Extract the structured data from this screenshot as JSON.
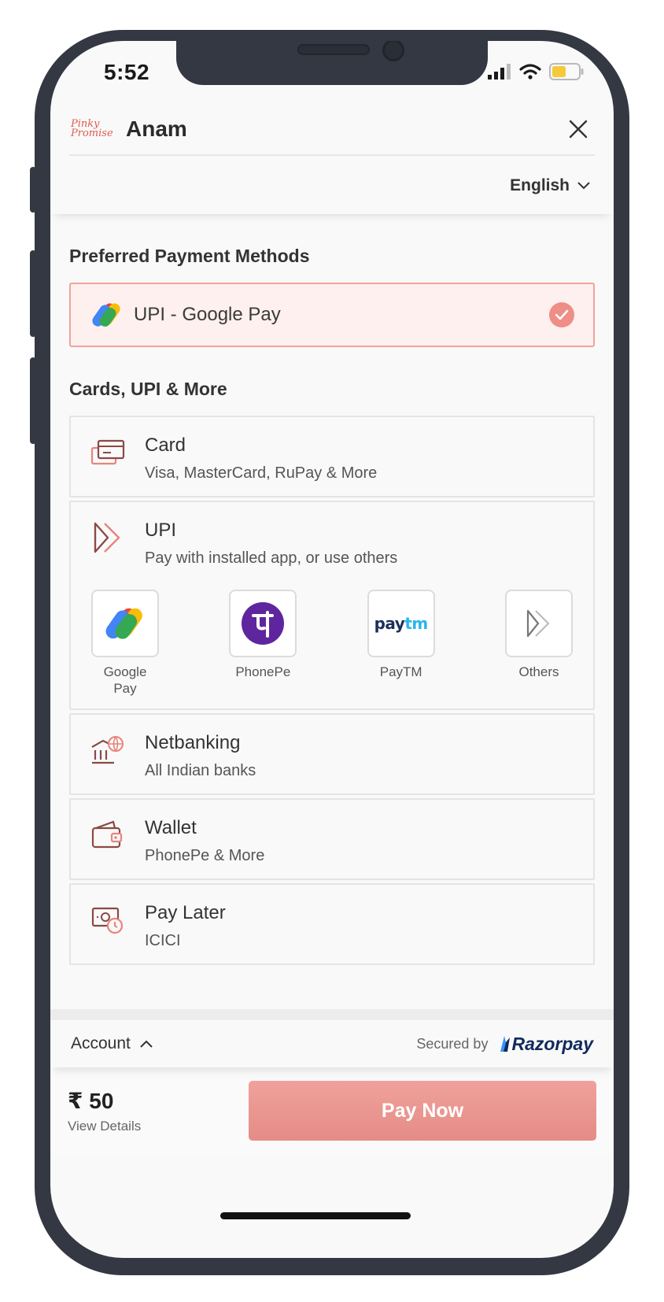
{
  "status_bar": {
    "time": "5:52"
  },
  "header": {
    "logo_line1": "Pinky",
    "logo_line2": "Promise",
    "merchant": "Anam"
  },
  "language": {
    "selected": "English"
  },
  "preferred": {
    "title": "Preferred Payment Methods",
    "item": "UPI - Google Pay"
  },
  "more": {
    "title": "Cards, UPI & More",
    "methods": [
      {
        "title": "Card",
        "subtitle": "Visa, MasterCard, RuPay & More"
      },
      {
        "title": "UPI",
        "subtitle": "Pay with installed app, or use others"
      },
      {
        "title": "Netbanking",
        "subtitle": "All Indian banks"
      },
      {
        "title": "Wallet",
        "subtitle": "PhonePe & More"
      },
      {
        "title": "Pay Later",
        "subtitle": "ICICI"
      }
    ],
    "upi_apps": [
      {
        "label": "Google Pay"
      },
      {
        "label": "PhonePe"
      },
      {
        "label": "PayTM",
        "logo_text": "paytm"
      },
      {
        "label": "Others"
      }
    ]
  },
  "footer": {
    "account": "Account",
    "secured_by": "Secured by",
    "brand": "Razorpay"
  },
  "pay": {
    "amount": "₹ 50",
    "view_details": "View Details",
    "button": "Pay Now"
  },
  "colors": {
    "accent": "#ee8e87",
    "brand_dark": "#102a5c",
    "frame": "#333842"
  }
}
